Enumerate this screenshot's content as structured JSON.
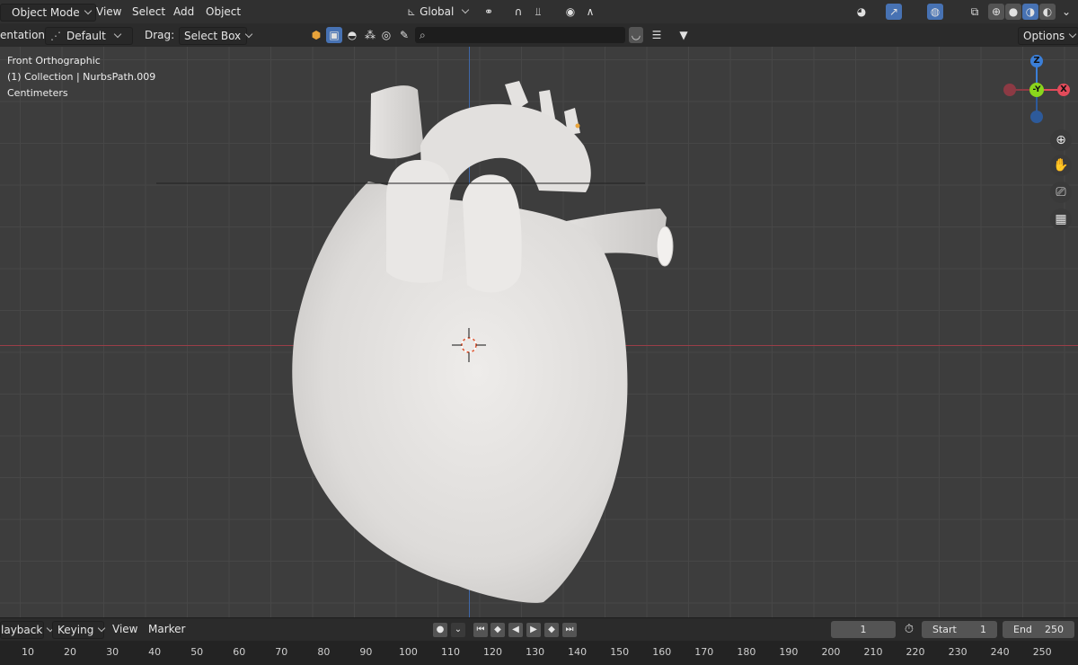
{
  "header": {
    "mode_label": "Object Mode",
    "menus": [
      "View",
      "Select",
      "Add",
      "Object"
    ],
    "transform_orientation": "Global",
    "options_label": "Options"
  },
  "toolbar2": {
    "orientation_label": "entation:",
    "orientation_value": "Default",
    "drag_label": "Drag:",
    "drag_value": "Select Box",
    "search_placeholder": ""
  },
  "viewport": {
    "view_name": "Front Orthographic",
    "collection_info": "(1) Collection | NurbsPath.009",
    "units": "Centimeters"
  },
  "gizmo": {
    "z_label": "Z",
    "y_label": "-Y",
    "x_label": "X",
    "x_color": "#e34b5a",
    "y_color": "#8ad51c",
    "z_color": "#3b7fd8"
  },
  "timeline": {
    "menus": [
      "layback",
      "Keying",
      "View",
      "Marker"
    ],
    "current_frame": "1",
    "start_label": "Start",
    "start_value": "1",
    "end_label": "End",
    "end_value": "250"
  },
  "ruler_ticks": [
    "10",
    "20",
    "30",
    "40",
    "50",
    "60",
    "70",
    "80",
    "90",
    "100",
    "110",
    "120",
    "130",
    "140",
    "150",
    "160",
    "170",
    "180",
    "190",
    "200",
    "210",
    "220",
    "230",
    "240",
    "250"
  ],
  "colors": {
    "header_bg": "#303030",
    "viewport_bg": "#3d3d3d",
    "accent": "#4772b3",
    "model": "#d8d6d4"
  }
}
